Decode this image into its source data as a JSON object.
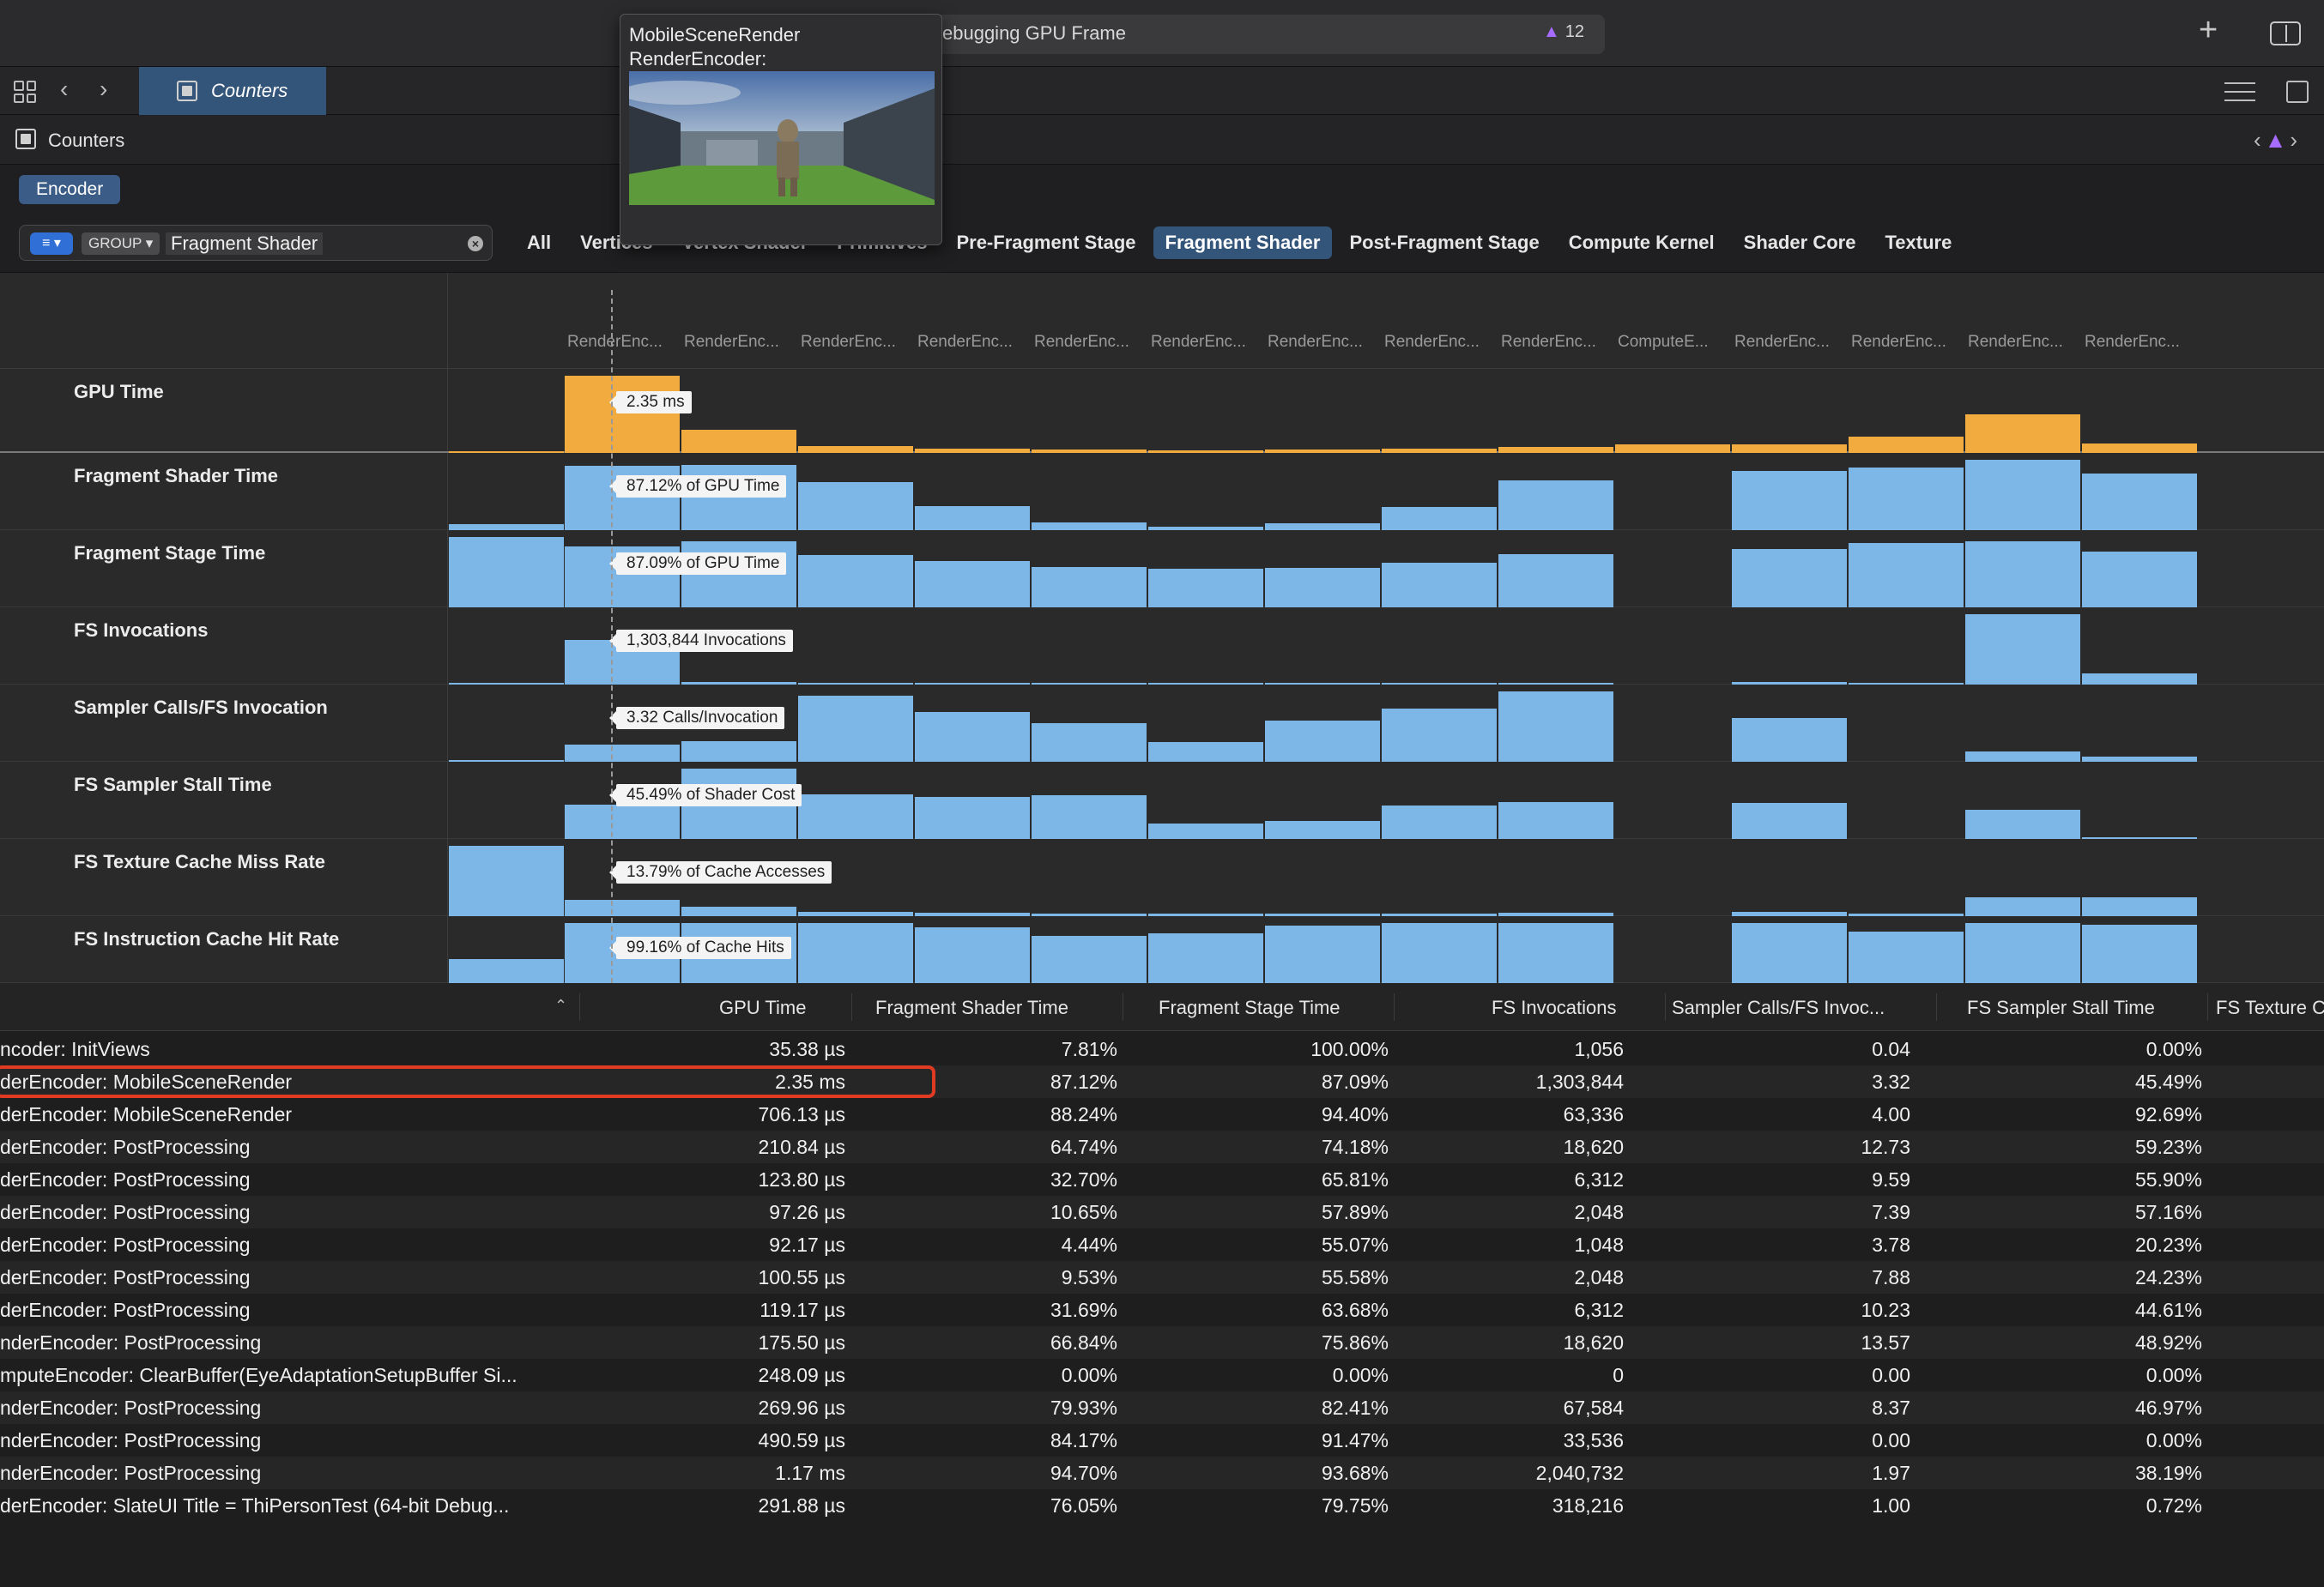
{
  "titlebar": {
    "title": "ebugging GPU Frame",
    "warning_count": "12"
  },
  "tabbar": {
    "active_tab": "Counters"
  },
  "breadcrumb": {
    "label": "Counters"
  },
  "group": {
    "button": "Encoder"
  },
  "filter": {
    "group_tag": "GROUP",
    "value": "Fragment Shader",
    "tabs": [
      "All",
      "Vertices",
      "Vertex Shader",
      "Primitives",
      "Pre-Fragment Stage",
      "Fragment Shader",
      "Post-Fragment Stage",
      "Compute Kernel",
      "Shader Core",
      "Texture"
    ],
    "active_tab": "Fragment Shader"
  },
  "popover": {
    "line1": "MobileSceneRender",
    "line2": "RenderEncoder:"
  },
  "chart_data": {
    "type": "bar",
    "categories": [
      "RenderEnc...",
      "RenderEnc...",
      "RenderEnc...",
      "RenderEnc...",
      "RenderEnc...",
      "RenderEnc...",
      "RenderEnc...",
      "RenderEnc...",
      "RenderEnc...",
      "ComputeE...",
      "RenderEnc...",
      "RenderEnc...",
      "RenderEnc...",
      "RenderEnc..."
    ],
    "series": [
      {
        "name": "GPU Time",
        "label": "2.35 ms",
        "values": [
          0.04,
          2.35,
          0.71,
          0.21,
          0.12,
          0.1,
          0.09,
          0.1,
          0.12,
          0.18,
          0.25,
          0.27,
          0.49,
          1.17,
          0.29
        ]
      },
      {
        "name": "Fragment Shader Time",
        "label": "87.12% of GPU Time",
        "values": [
          7.81,
          87.12,
          88.24,
          64.74,
          32.7,
          10.65,
          4.44,
          9.53,
          31.69,
          66.84,
          0.0,
          79.93,
          84.17,
          94.7,
          76.05
        ]
      },
      {
        "name": "Fragment Stage Time",
        "label": "87.09% of GPU Time",
        "values": [
          100.0,
          87.09,
          94.4,
          74.18,
          65.81,
          57.89,
          55.07,
          55.58,
          63.68,
          75.86,
          0.0,
          82.41,
          91.47,
          93.68,
          79.75
        ]
      },
      {
        "name": "FS Invocations",
        "label": "1,303,844 Invocations",
        "values": [
          1056,
          1303844,
          63336,
          18620,
          6312,
          2048,
          1048,
          2048,
          6312,
          18620,
          0,
          67584,
          33536,
          2040732,
          318216
        ]
      },
      {
        "name": "Sampler Calls/FS Invocation",
        "label": "3.32 Calls/Invocation",
        "values": [
          0.04,
          3.32,
          4.0,
          12.73,
          9.59,
          7.39,
          3.78,
          7.88,
          10.23,
          13.57,
          0.0,
          8.37,
          0.0,
          1.97,
          1.0
        ]
      },
      {
        "name": "FS Sampler Stall Time",
        "label": "45.49% of Shader Cost",
        "values": [
          0.0,
          45.49,
          92.69,
          59.23,
          55.9,
          57.16,
          20.23,
          24.23,
          44.61,
          48.92,
          0.0,
          46.97,
          0.0,
          38.19,
          0.72
        ]
      },
      {
        "name": "FS Texture Cache Miss Rate",
        "label": "13.79% of Cache Accesses",
        "values": [
          60,
          13.79,
          8,
          4,
          3,
          2,
          2,
          2,
          2,
          3,
          0,
          4,
          2,
          16,
          16
        ]
      },
      {
        "name": "FS Instruction Cache Hit Rate",
        "label": "99.16% of Cache Hits",
        "values": [
          40,
          99.16,
          99,
          99,
          92,
          78,
          82,
          95,
          99,
          99,
          0,
          99,
          85,
          99,
          97
        ]
      }
    ]
  },
  "table": {
    "columns": [
      "GPU Time",
      "Fragment Shader Time",
      "Fragment Stage Time",
      "FS Invocations",
      "Sampler Calls/FS Invoc...",
      "FS Sampler Stall Time",
      "FS Texture C"
    ],
    "rows": [
      [
        "ncoder: InitViews",
        "35.38 µs",
        "7.81%",
        "100.00%",
        "1,056",
        "0.04",
        "0.00%"
      ],
      [
        "derEncoder: MobileSceneRender",
        "2.35 ms",
        "87.12%",
        "87.09%",
        "1,303,844",
        "3.32",
        "45.49%"
      ],
      [
        "derEncoder: MobileSceneRender",
        "706.13 µs",
        "88.24%",
        "94.40%",
        "63,336",
        "4.00",
        "92.69%"
      ],
      [
        "derEncoder: PostProcessing",
        "210.84 µs",
        "64.74%",
        "74.18%",
        "18,620",
        "12.73",
        "59.23%"
      ],
      [
        "derEncoder: PostProcessing",
        "123.80 µs",
        "32.70%",
        "65.81%",
        "6,312",
        "9.59",
        "55.90%"
      ],
      [
        "derEncoder: PostProcessing",
        "97.26 µs",
        "10.65%",
        "57.89%",
        "2,048",
        "7.39",
        "57.16%"
      ],
      [
        "derEncoder: PostProcessing",
        "92.17 µs",
        "4.44%",
        "55.07%",
        "1,048",
        "3.78",
        "20.23%"
      ],
      [
        "derEncoder: PostProcessing",
        "100.55 µs",
        "9.53%",
        "55.58%",
        "2,048",
        "7.88",
        "24.23%"
      ],
      [
        "derEncoder: PostProcessing",
        "119.17 µs",
        "31.69%",
        "63.68%",
        "6,312",
        "10.23",
        "44.61%"
      ],
      [
        "nderEncoder: PostProcessing",
        "175.50 µs",
        "66.84%",
        "75.86%",
        "18,620",
        "13.57",
        "48.92%"
      ],
      [
        "mputeEncoder: ClearBuffer(EyeAdaptationSetupBuffer Si...",
        "248.09 µs",
        "0.00%",
        "0.00%",
        "0",
        "0.00",
        "0.00%"
      ],
      [
        "nderEncoder: PostProcessing",
        "269.96 µs",
        "79.93%",
        "82.41%",
        "67,584",
        "8.37",
        "46.97%"
      ],
      [
        "nderEncoder: PostProcessing",
        "490.59 µs",
        "84.17%",
        "91.47%",
        "33,536",
        "0.00",
        "0.00%"
      ],
      [
        "nderEncoder: PostProcessing",
        "1.17 ms",
        "94.70%",
        "93.68%",
        "2,040,732",
        "1.97",
        "38.19%"
      ],
      [
        "derEncoder: SlateUI Title = ThiPersonTest (64-bit Debug...",
        "291.88 µs",
        "76.05%",
        "79.75%",
        "318,216",
        "1.00",
        "0.72%"
      ]
    ],
    "selected_row": 1
  },
  "colors": {
    "gpu_time_bar": "#f2ab3e",
    "counter_bar": "#7db7e8",
    "selection_accent": "#34557a",
    "highlight_box": "#e03a22",
    "warning": "#a66bff"
  }
}
